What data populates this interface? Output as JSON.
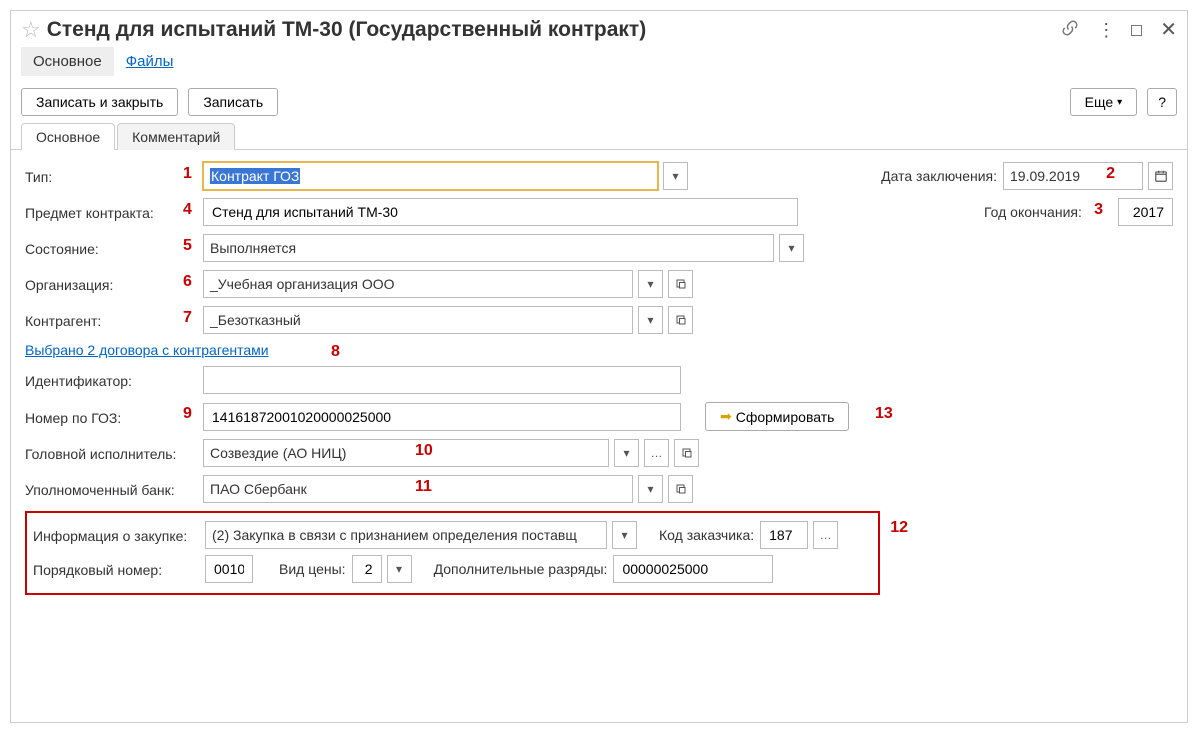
{
  "title": "Стенд для испытаний ТМ-30 (Государственный контракт)",
  "subtabs": {
    "main": "Основное",
    "files": "Файлы"
  },
  "toolbar": {
    "save_close": "Записать и закрыть",
    "save": "Записать",
    "more": "Еще",
    "help": "?"
  },
  "tabs": {
    "main": "Основное",
    "comment": "Комментарий"
  },
  "labels": {
    "type": "Тип:",
    "date": "Дата заключения:",
    "subject": "Предмет контракта:",
    "year_end": "Год окончания:",
    "state": "Состояние:",
    "org": "Организация:",
    "counterparty": "Контрагент:",
    "contracts_link": "Выбрано 2 договора с контрагентами",
    "identifier": "Идентификатор:",
    "goz_number": "Номер по ГОЗ:",
    "generate": "Сформировать",
    "head_exec": "Головной исполнитель:",
    "bank": "Уполномоченный банк:",
    "purchase_info": "Информация о закупке:",
    "customer_code": "Код заказчика:",
    "seq_number": "Порядковый номер:",
    "price_kind": "Вид цены:",
    "extra_digits": "Дополнительные разряды:"
  },
  "values": {
    "type": "Контракт ГОЗ",
    "date": "19.09.2019",
    "subject": "Стенд для испытаний ТМ-30",
    "year_end": "2017",
    "state": "Выполняется",
    "org": "_Учебная организация ООО",
    "counterparty": "_Безотказный",
    "identifier": "",
    "goz_number": "14161872001020000025000",
    "head_exec": "Созвездие (АО НИЦ)",
    "bank": "ПАО Сбербанк",
    "purchase_info": "(2) Закупка в связи с признанием определения поставщ",
    "customer_code": "187",
    "seq_number": "0010",
    "price_kind": "2",
    "extra_digits": "00000025000"
  },
  "badges": {
    "b1": "1",
    "b2": "2",
    "b3": "3",
    "b4": "4",
    "b5": "5",
    "b6": "6",
    "b7": "7",
    "b8": "8",
    "b9": "9",
    "b10": "10",
    "b11": "11",
    "b12": "12",
    "b13": "13"
  }
}
